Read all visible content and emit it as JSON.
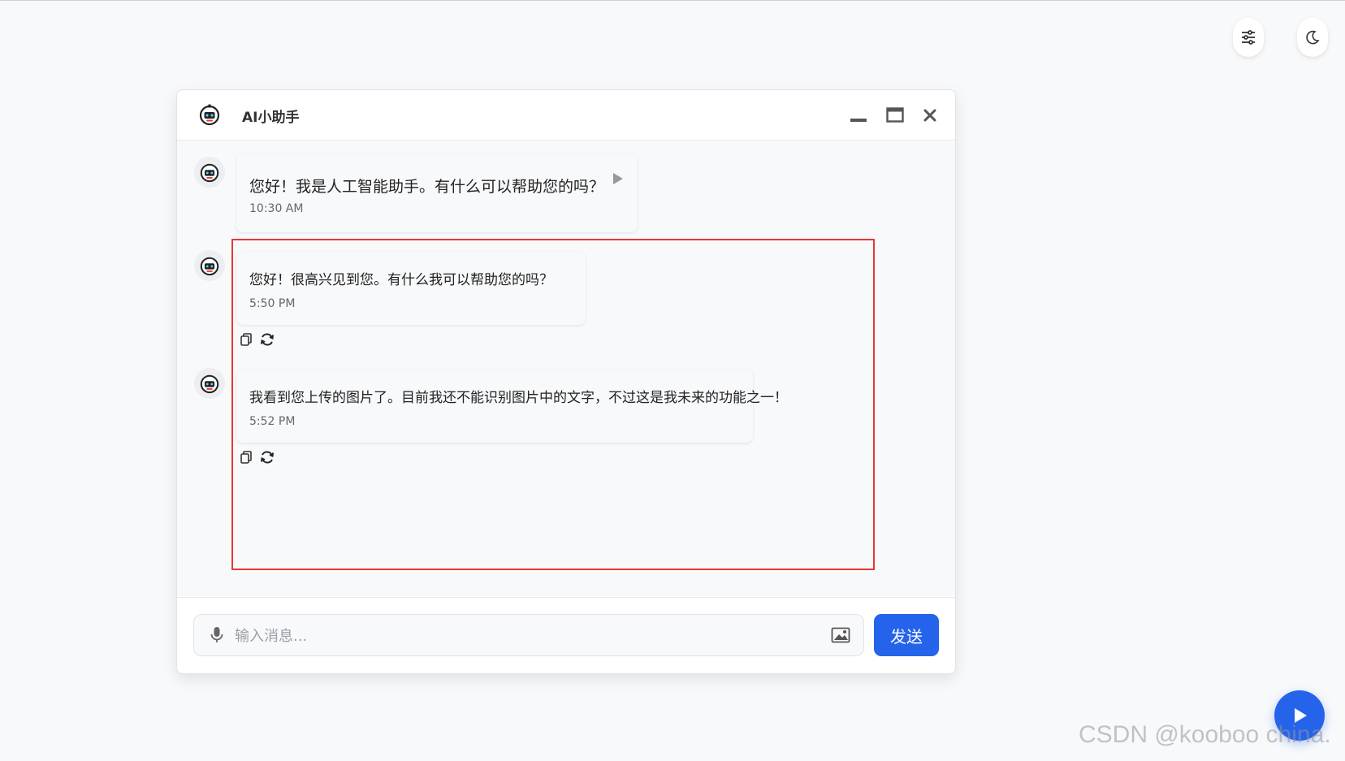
{
  "app": {
    "title": "AI小助手"
  },
  "icons": {
    "settings": "sliders-icon",
    "theme": "moon-icon",
    "logo": "robot-icon",
    "minimize": "minimize-icon",
    "maximize": "maximize-icon",
    "close": "close-icon",
    "play": "play-icon",
    "copy": "copy-icon",
    "refresh": "refresh-icon",
    "mic": "microphone-icon",
    "image": "image-icon"
  },
  "messages": [
    {
      "text": "您好！我是人工智能助手。有什么可以帮助您的吗？",
      "time": "10:30 AM"
    },
    {
      "text": "您好！很高兴见到您。有什么我可以帮助您的吗？",
      "time": "5:50 PM"
    },
    {
      "text": "我看到您上传的图片了。目前我还不能识别图片中的文字，不过这是我未来的功能之一！",
      "time": "5:52 PM"
    }
  ],
  "input": {
    "placeholder": "输入消息...",
    "value": ""
  },
  "send_button": {
    "label": "发送"
  },
  "watermark": "CSDN @kooboo china.",
  "colors": {
    "primary": "#2563eb",
    "highlight": "#e53935",
    "background": "#f8f9fb"
  }
}
